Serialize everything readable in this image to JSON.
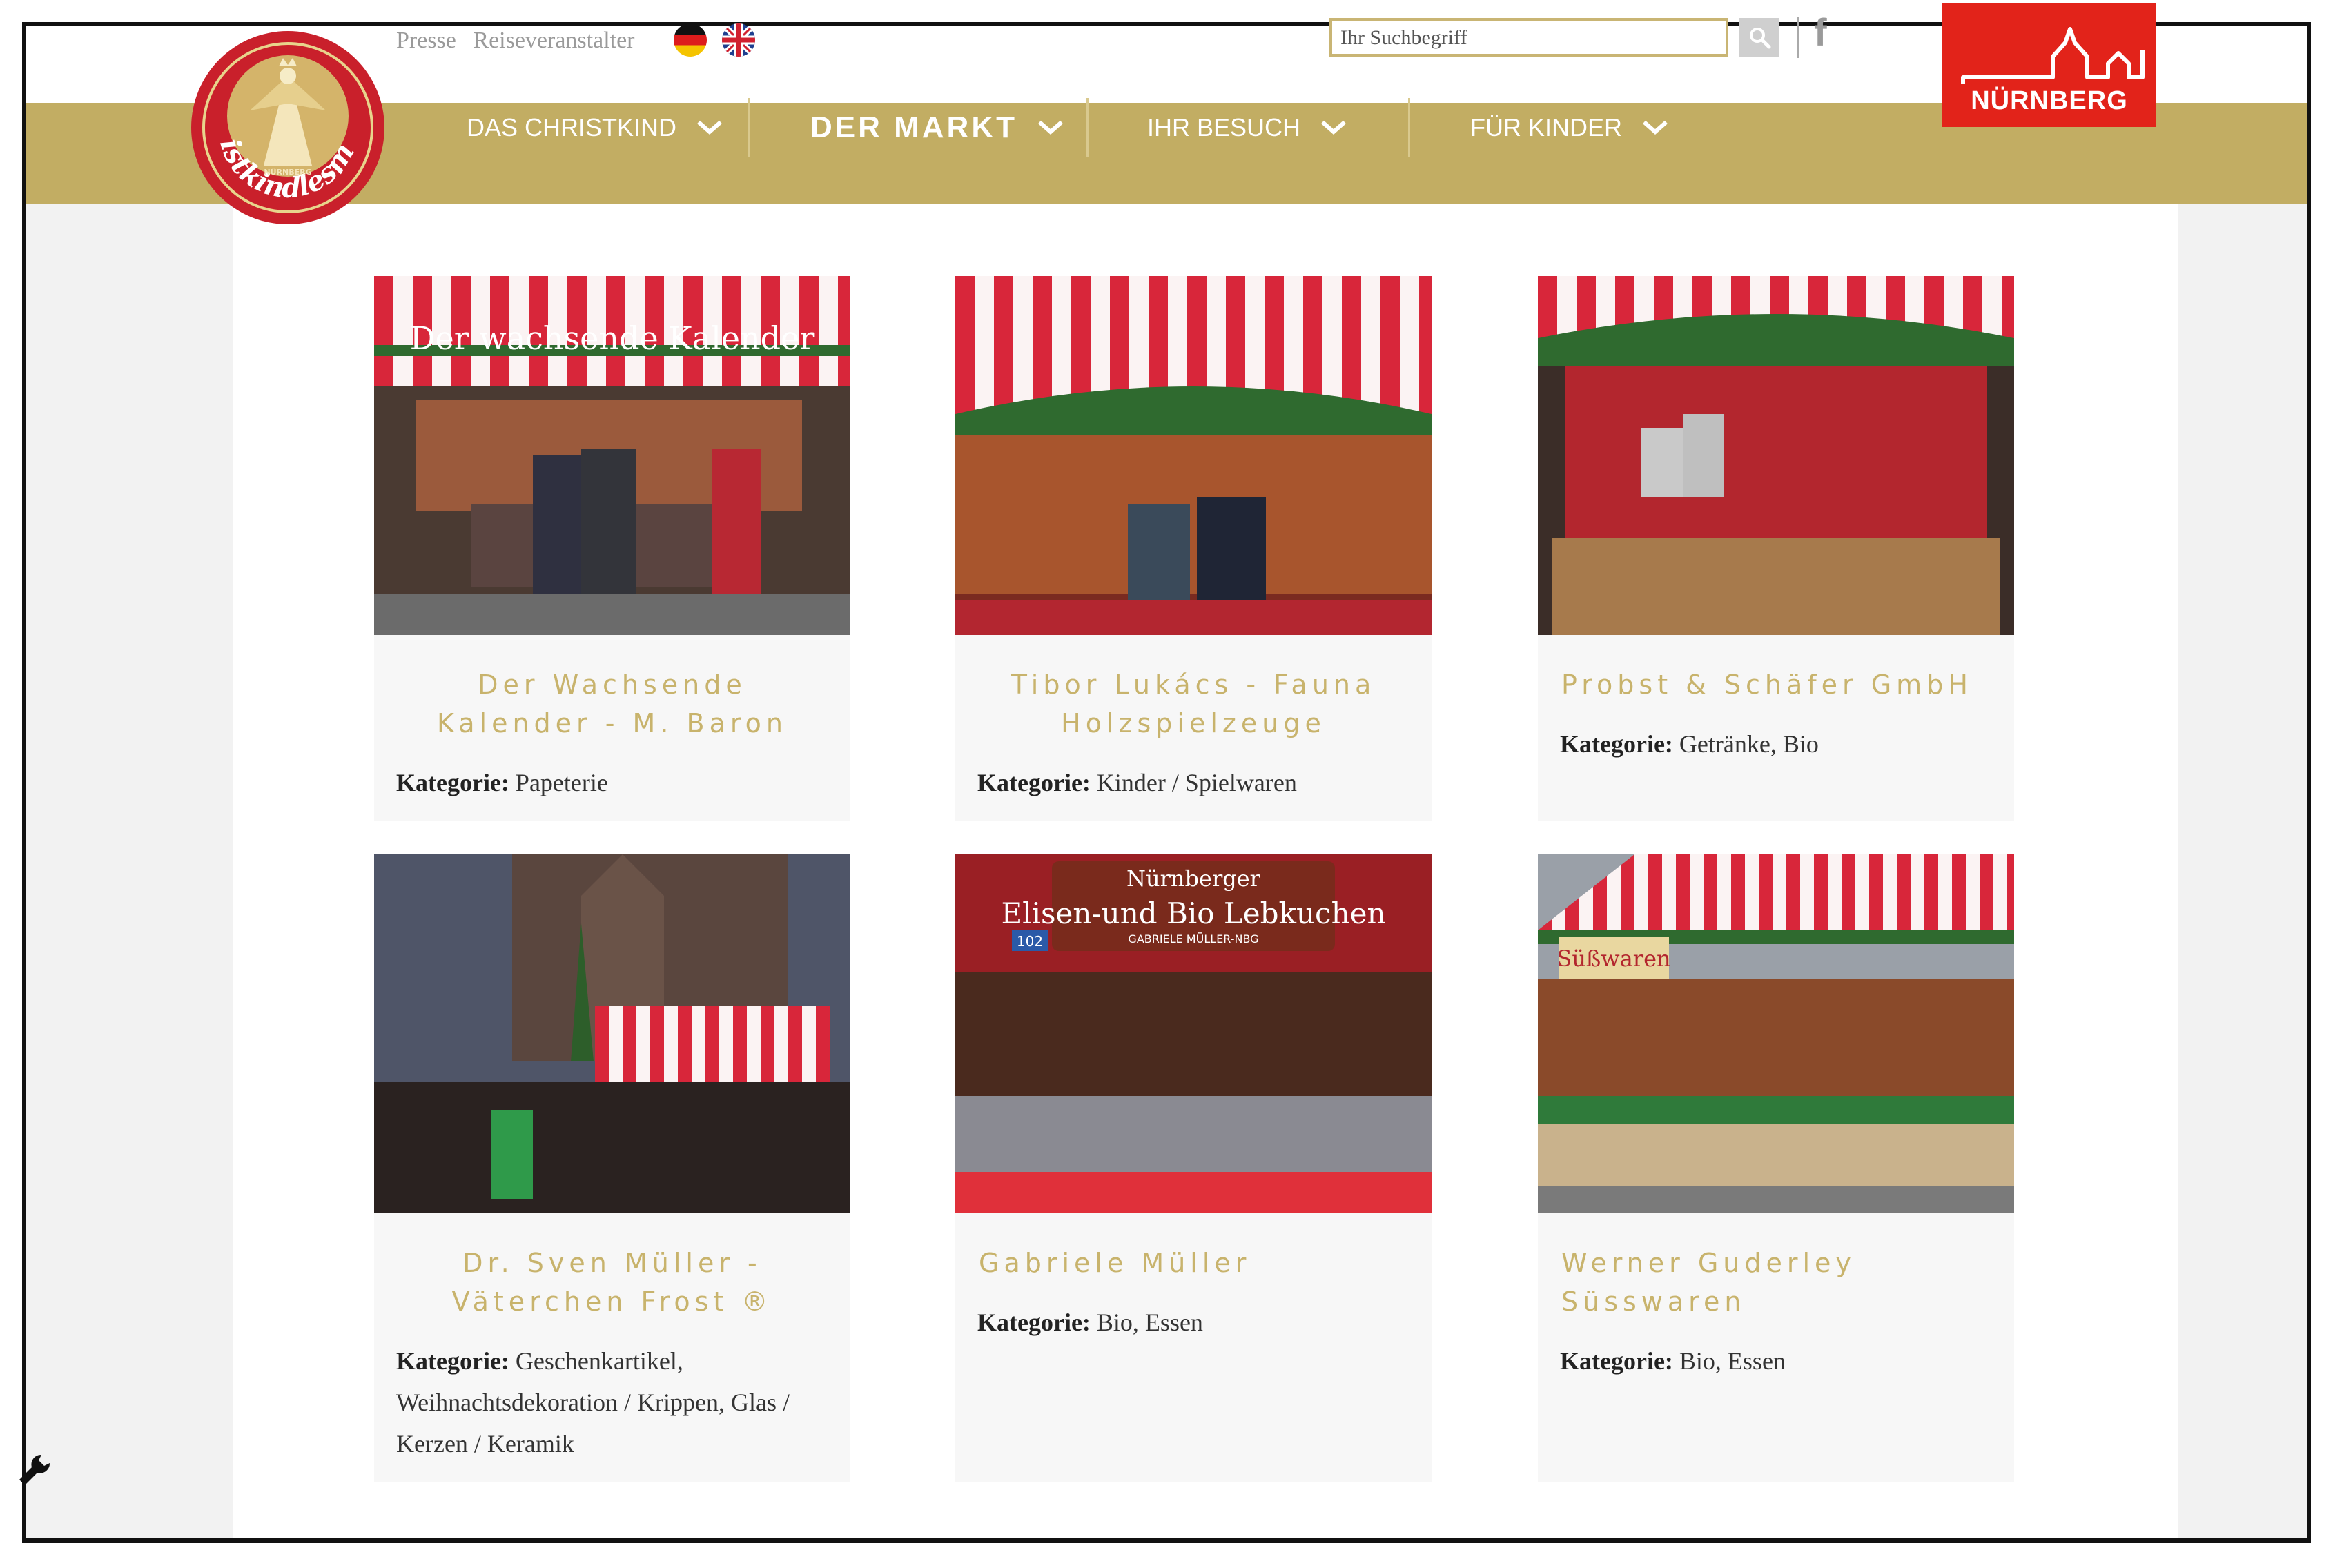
{
  "header": {
    "links": [
      "Presse",
      "Reiseveranstalter"
    ],
    "search_placeholder": "Ihr Suchbegriff",
    "facebook_label": "f",
    "city_logo_text": "NÜRNBERG",
    "logo_text": "Christkindlesmarkt",
    "logo_subtext": "NÜRNBERG"
  },
  "nav": {
    "items": [
      {
        "label": "DAS CHRISTKIND"
      },
      {
        "label": "DER MARKT"
      },
      {
        "label": "IHR BESUCH"
      },
      {
        "label": "FÜR KINDER"
      }
    ]
  },
  "cards": [
    {
      "title": "Der Wachsende Kalender - M. Baron",
      "category_label": "Kategorie:",
      "category": "Papeterie",
      "sign": "Der wachsende Kalender"
    },
    {
      "title": "Tibor Lukács - Fauna Holzspielzeuge",
      "category_label": "Kategorie:",
      "category": "Kinder / Spielwaren"
    },
    {
      "title": "Probst & Schäfer GmbH",
      "category_label": "Kategorie:",
      "category": "Getränke, Bio"
    },
    {
      "title": "Dr. Sven Müller - Väterchen Frost ®",
      "category_label": "Kategorie:",
      "category": "Geschenkartikel, Weihnachtsdekoration / Krippen, Glas / Kerzen / Keramik"
    },
    {
      "title": "Gabriele Müller",
      "category_label": "Kategorie:",
      "category": "Bio, Essen",
      "sign_top": "Nürnberger",
      "sign": "Elisen-und Bio Lebkuchen",
      "sign_sub": "GABRIELE MÜLLER-NBG",
      "stall_number": "102"
    },
    {
      "title": "Werner Guderley Süsswaren",
      "category_label": "Kategorie:",
      "category": "Bio, Essen",
      "sign": "Süßwaren"
    }
  ],
  "colors": {
    "nav_gold": "#c2ad63",
    "title_gold": "#c8b36c",
    "nuernberg_red": "#e2231a"
  }
}
